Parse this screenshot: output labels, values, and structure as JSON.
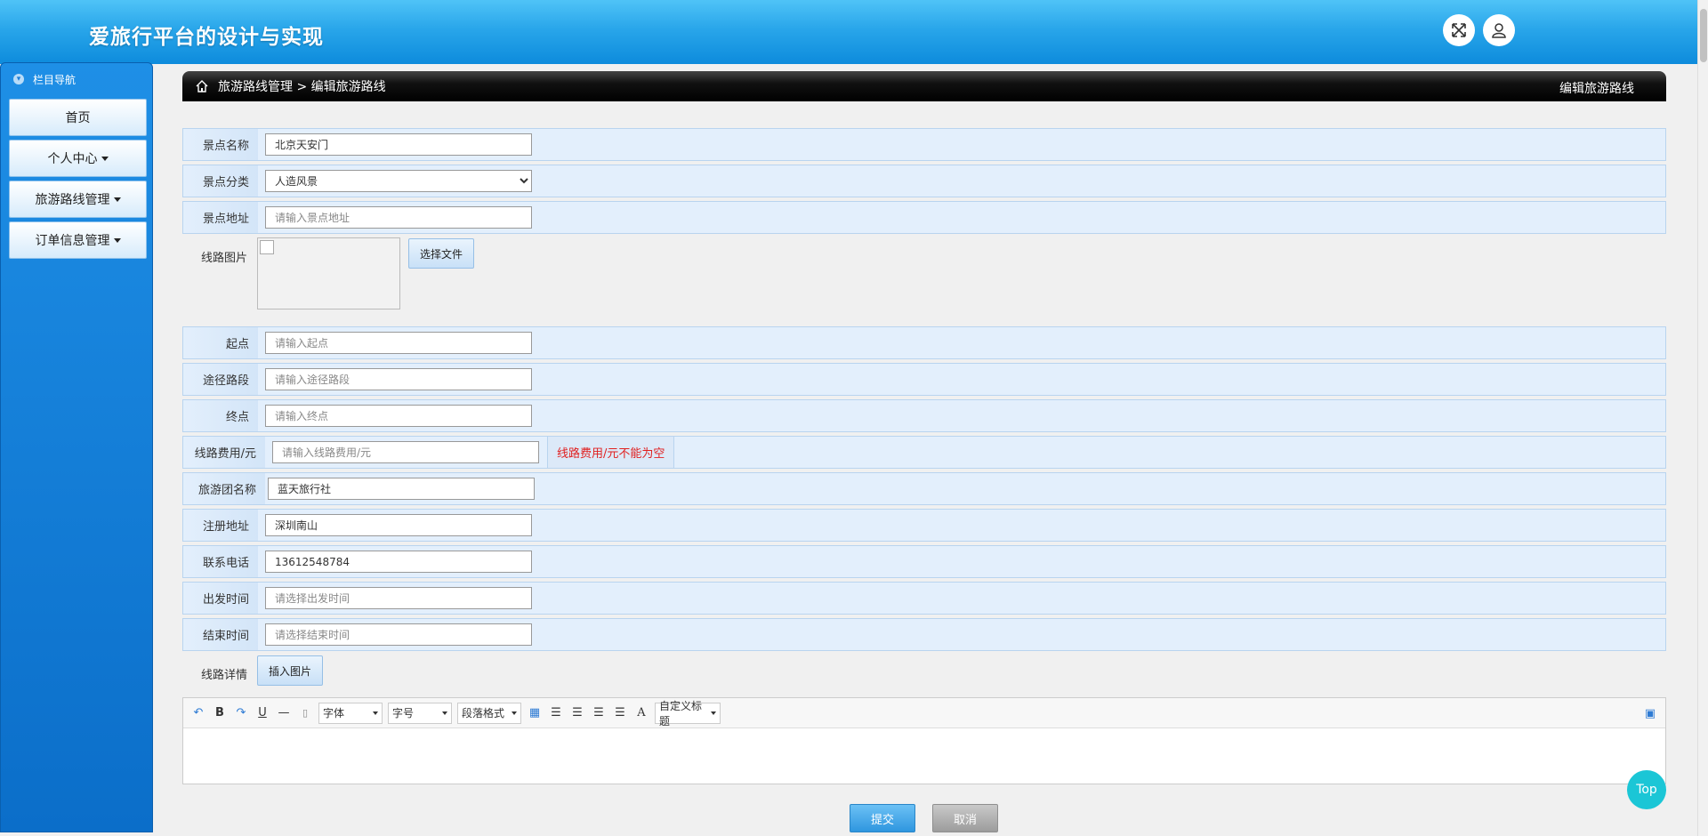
{
  "header": {
    "title": "爱旅行平台的设计与实现"
  },
  "sidebar": {
    "heading": "栏目导航",
    "items": [
      {
        "label": "首页",
        "has_caret": false
      },
      {
        "label": "个人中心",
        "has_caret": true
      },
      {
        "label": "旅游路线管理",
        "has_caret": true
      },
      {
        "label": "订单信息管理",
        "has_caret": true
      }
    ]
  },
  "breadcrumb": {
    "path": "旅游路线管理 > 编辑旅游路线",
    "right_title": "编辑旅游路线"
  },
  "form": {
    "name": {
      "label": "景点名称",
      "value": "北京天安门"
    },
    "category": {
      "label": "景点分类",
      "selected": "人造风景"
    },
    "address": {
      "label": "景点地址",
      "placeholder": "请输入景点地址"
    },
    "image": {
      "label": "线路图片",
      "button": "选择文件"
    },
    "start": {
      "label": "起点",
      "placeholder": "请输入起点"
    },
    "route": {
      "label": "途径路段",
      "placeholder": "请输入途径路段"
    },
    "end": {
      "label": "终点",
      "placeholder": "请输入终点"
    },
    "fee": {
      "label": "线路费用/元",
      "placeholder": "请输入线路费用/元",
      "error": "线路费用/元不能为空"
    },
    "agency": {
      "label": "旅游团名称",
      "value": "蓝天旅行社"
    },
    "reg_address": {
      "label": "注册地址",
      "value": "深圳南山"
    },
    "phone": {
      "label": "联系电话",
      "value": "13612548784"
    },
    "depart": {
      "label": "出发时间",
      "placeholder": "请选择出发时间"
    },
    "finish": {
      "label": "结束时间",
      "placeholder": "请选择结束时间"
    },
    "detail": {
      "label": "线路详情",
      "button": "插入图片"
    }
  },
  "editor": {
    "font": "字体",
    "size": "字号",
    "paragraph": "段落格式",
    "custom_title": "自定义标题"
  },
  "actions": {
    "submit": "提交",
    "cancel": "取消",
    "top": "Top"
  },
  "colors": {
    "header": "#1e9be4",
    "sidebar": "#0b6ec9",
    "row_bg": "#e3effc",
    "error": "#e02020",
    "fab": "#1bc6d6"
  }
}
